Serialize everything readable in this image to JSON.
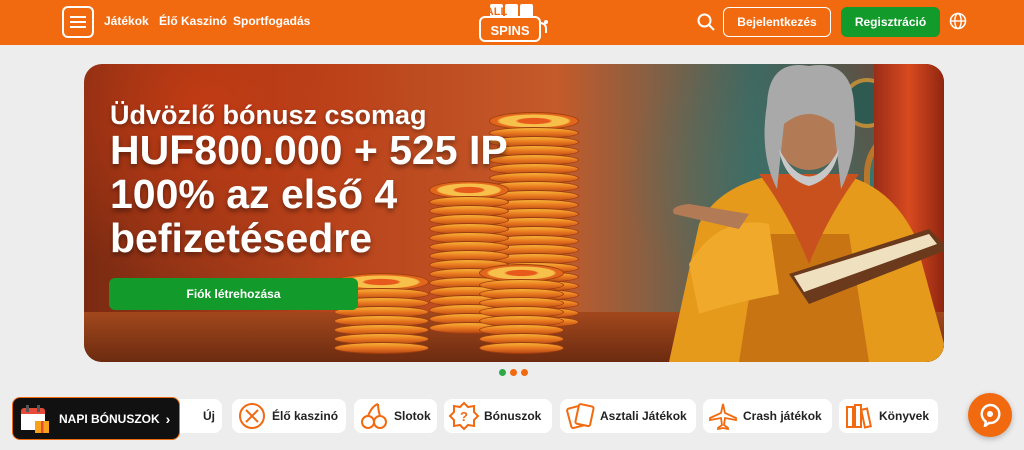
{
  "header": {
    "nav": [
      "Játékok",
      "Élő Kaszinó",
      "Sportfogadás"
    ],
    "logo_text": [
      "ALL",
      "SPINS"
    ],
    "login_label": "Bejelentkezés",
    "register_label": "Regisztráció",
    "icons": [
      "menu-icon",
      "search-icon",
      "globe-icon"
    ]
  },
  "hero": {
    "title": "Üdvözlő bónusz csomag",
    "amount": "HUF800.000 + 525 IP",
    "line2": "100% az első 4",
    "line3": "befizetésedre",
    "cta_label": "Fiók létrehozása",
    "slides": 3,
    "active_slide": 1
  },
  "categories": [
    {
      "label": "Új",
      "icon": "new-icon"
    },
    {
      "label": "Élő kaszinó",
      "icon": "live-casino-icon"
    },
    {
      "label": "Slotok",
      "icon": "cherries-icon"
    },
    {
      "label": "Bónuszok",
      "icon": "bonus-icon"
    },
    {
      "label": "Asztali Játékok",
      "icon": "cards-icon"
    },
    {
      "label": "Crash játékok",
      "icon": "plane-icon"
    },
    {
      "label": "Könyvek",
      "icon": "books-icon"
    }
  ],
  "napi": {
    "label": "NAPI BÓNUSZOK",
    "chevron": "›"
  },
  "colors": {
    "brand_orange": "#f26a10",
    "cta_green": "#129a2a",
    "dot_green": "#2fa84a"
  }
}
